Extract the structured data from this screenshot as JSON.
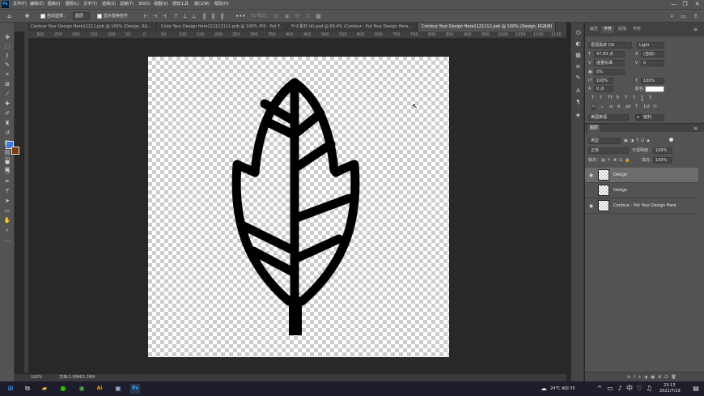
{
  "app": {
    "logo": "Ps",
    "accent": "#31a8ff"
  },
  "menu": [
    "文件(F)",
    "编辑(E)",
    "图像(I)",
    "图层(L)",
    "文字(Y)",
    "选择(S)",
    "滤镜(T)",
    "3D(D)",
    "视图(V)",
    "增效工具",
    "窗口(W)",
    "帮助(H)"
  ],
  "window_controls": {
    "minimize": "—",
    "maximize": "❐",
    "close": "✕"
  },
  "options": {
    "auto_select_label": "自动选择：",
    "auto_select_value": "图层",
    "show_transform_label": "显示变换控件",
    "mode_3d": "3D 模式："
  },
  "tabs": [
    {
      "label": "Contour Your Design Here11211.psb @ 100% (Design, RG...",
      "active": false
    },
    {
      "label": "Color Your Design Here222112111.psb @ 100% (Fill - Put Y...",
      "active": false
    },
    {
      "label": "叶子素材 (4).psd @ 69.4% (Contour - Put Your Design Here...",
      "active": false
    },
    {
      "label": "Contour Your Design Here1121112.psb @ 100% (Design, RGB/8)",
      "active": true
    }
  ],
  "ruler_h": [
    "300",
    "250",
    "200",
    "150",
    "100",
    "50",
    "0",
    "50",
    "100",
    "150",
    "200",
    "250",
    "300",
    "350",
    "400",
    "450",
    "500",
    "550",
    "600",
    "650",
    "700",
    "750",
    "800",
    "850",
    "900",
    "950",
    "1000",
    "1050",
    "1100",
    "1150"
  ],
  "status": {
    "zoom": "100%",
    "doc": "文档:1.93M/5.26M"
  },
  "character_panel": {
    "tabs": [
      "属性",
      "字符",
      "段落",
      "字形"
    ],
    "font_family": "思源黑体 CN",
    "font_style": "Light",
    "font_size": "47.83 点",
    "leading": "(自动)",
    "kerning": "度量标准",
    "tracking": "0",
    "tsume": "0%",
    "vscale": "100%",
    "hscale": "100%",
    "baseline": "0 点",
    "color_label": "颜色：",
    "style_buttons": [
      "T",
      "T",
      "TT",
      "Tr",
      "T'",
      "T,",
      "T",
      "Ŧ"
    ],
    "ot_buttons": [
      "fi",
      "ℴ",
      "st",
      "A",
      "ad",
      "T",
      "1st",
      "½"
    ],
    "language": "美国英语",
    "aa": "a",
    "aa_mode": "锐利"
  },
  "layers_panel": {
    "title": "图层",
    "filter_kind": "类型",
    "blend_mode": "正常",
    "opacity_label": "不透明度：",
    "opacity": "100%",
    "lock_label": "锁定：",
    "fill_label": "填充：",
    "fill": "100%",
    "layers": [
      {
        "name": "Design",
        "visible": true,
        "selected": true
      },
      {
        "name": "Design",
        "visible": false,
        "selected": false
      },
      {
        "name": "Contour - Put Your Design Here",
        "visible": true,
        "selected": false
      }
    ]
  },
  "taskbar": {
    "weather": "24°C  AQI 35",
    "time": "23:13",
    "date": "2021/7/19"
  }
}
